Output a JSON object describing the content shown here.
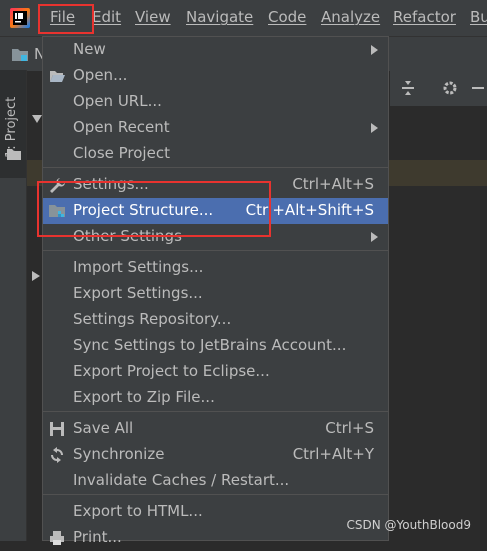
{
  "menubar": {
    "items": [
      "File",
      "Edit",
      "View",
      "Navigate",
      "Code",
      "Analyze",
      "Refactor",
      "Bu"
    ]
  },
  "navbar": {
    "project_initial": "N"
  },
  "toolstrip": {
    "project_tab_label": "1: Project"
  },
  "file_menu": {
    "items": [
      {
        "label": "New",
        "shortcut": "",
        "submenu": true
      },
      {
        "label": "Open...",
        "shortcut": "",
        "submenu": false,
        "icon": "folder-open-icon"
      },
      {
        "label": "Open URL...",
        "shortcut": "",
        "submenu": false
      },
      {
        "label": "Open Recent",
        "shortcut": "",
        "submenu": true
      },
      {
        "label": "Close Project",
        "shortcut": "",
        "submenu": false
      },
      {
        "label": "Settings...",
        "shortcut": "Ctrl+Alt+S",
        "submenu": false,
        "icon": "wrench-icon"
      },
      {
        "label": "Project Structure...",
        "shortcut": "Ctrl+Alt+Shift+S",
        "submenu": false,
        "icon": "project-structure-icon",
        "selected": true
      },
      {
        "label": "Other Settings",
        "shortcut": "",
        "submenu": true
      },
      {
        "label": "Import Settings...",
        "shortcut": "",
        "submenu": false
      },
      {
        "label": "Export Settings...",
        "shortcut": "",
        "submenu": false
      },
      {
        "label": "Settings Repository...",
        "shortcut": "",
        "submenu": false
      },
      {
        "label": "Sync Settings to JetBrains Account...",
        "shortcut": "",
        "submenu": false
      },
      {
        "label": "Export Project to Eclipse...",
        "shortcut": "",
        "submenu": false
      },
      {
        "label": "Export to Zip File...",
        "shortcut": "",
        "submenu": false
      },
      {
        "label": "Save All",
        "shortcut": "Ctrl+S",
        "submenu": false,
        "icon": "save-icon"
      },
      {
        "label": "Synchronize",
        "shortcut": "Ctrl+Alt+Y",
        "submenu": false,
        "icon": "sync-icon"
      },
      {
        "label": "Invalidate Caches / Restart...",
        "shortcut": "",
        "submenu": false
      },
      {
        "label": "Export to HTML...",
        "shortcut": "",
        "submenu": false
      },
      {
        "label": "Print...",
        "shortcut": "",
        "submenu": false,
        "icon": "print-icon"
      }
    ]
  },
  "colors": {
    "menu_bg": "#3c3f41",
    "selection": "#4b6eaf",
    "annotation_red": "#e8332f"
  },
  "watermark": "CSDN @YouthBlood9"
}
